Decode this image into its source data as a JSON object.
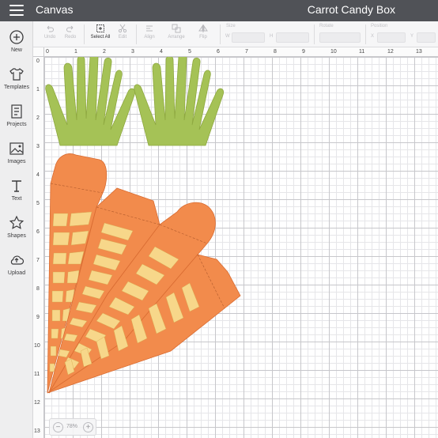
{
  "header": {
    "app_title": "Canvas",
    "project_title": "Carrot Candy Box"
  },
  "nav": [
    {
      "label": "New",
      "icon": "plus-circle-icon"
    },
    {
      "label": "Templates",
      "icon": "shirt-icon"
    },
    {
      "label": "Projects",
      "icon": "projects-icon"
    },
    {
      "label": "Images",
      "icon": "image-icon"
    },
    {
      "label": "Text",
      "icon": "text-icon"
    },
    {
      "label": "Shapes",
      "icon": "shapes-icon"
    },
    {
      "label": "Upload",
      "icon": "upload-cloud-icon"
    }
  ],
  "toolbar": {
    "undo": "Undo",
    "redo": "Redo",
    "select_all": "Select All",
    "edit": "Edit",
    "align": "Align",
    "arrange": "Arrange",
    "flip": "Flip",
    "size_label": "Size",
    "w": "W",
    "h": "H",
    "rotate_label": "Rotate",
    "position_label": "Position",
    "x": "X",
    "y": "Y"
  },
  "ruler": {
    "top": [
      "0",
      "1",
      "2",
      "3",
      "4",
      "5",
      "6",
      "7",
      "8",
      "9",
      "10",
      "11",
      "12",
      "13"
    ],
    "left": [
      "0",
      "1",
      "2",
      "3",
      "4",
      "5",
      "6",
      "7",
      "8",
      "9",
      "10",
      "11",
      "12",
      "13"
    ]
  },
  "zoom": {
    "value": "78%",
    "minus": "−",
    "plus": "+"
  },
  "colors": {
    "header": "#505257",
    "carrot_orange": "#f28b4c",
    "carrot_stripe": "#f7d78a",
    "leaf_green": "#a5c256"
  }
}
